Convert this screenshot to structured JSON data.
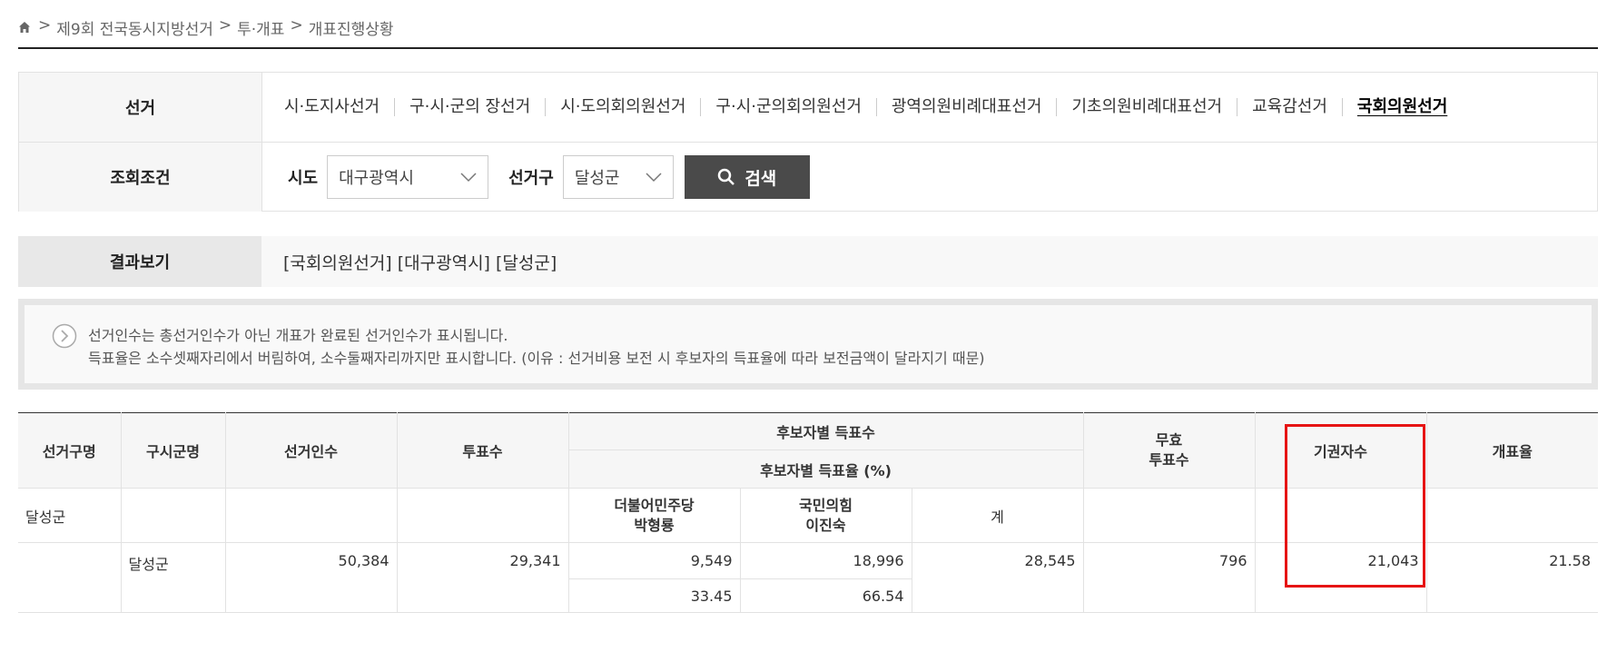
{
  "breadcrumb": {
    "items": [
      "제9회 전국동시지방선거",
      "투·개표",
      "개표진행상황"
    ],
    "separator": ">"
  },
  "search": {
    "election_label": "선거",
    "election_tabs": [
      {
        "label": "시·도지사선거",
        "active": false
      },
      {
        "label": "구·시·군의 장선거",
        "active": false
      },
      {
        "label": "시·도의회의원선거",
        "active": false
      },
      {
        "label": "구·시·군의회의원선거",
        "active": false
      },
      {
        "label": "광역의원비례대표선거",
        "active": false
      },
      {
        "label": "기초의원비례대표선거",
        "active": false
      },
      {
        "label": "교육감선거",
        "active": false
      },
      {
        "label": "국회의원선거",
        "active": true
      }
    ],
    "condition_label": "조회조건",
    "sido_label": "시도",
    "sido_value": "대구광역시",
    "district_label": "선거구",
    "district_value": "달성군",
    "search_button": "검색"
  },
  "result": {
    "label": "결과보기",
    "text": "[국회의원선거] [대구광역시] [달성군]"
  },
  "notice": {
    "line1": "선거인수는 총선거인수가 아닌 개표가 완료된 선거인수가 표시됩니다.",
    "line2": "득표율은 소수셋째자리에서 버림하여, 소수둘째자리까지만 표시합니다. (이유 : 선거비용 보전 시 후보자의 득표율에 따라 보전금액이 달라지기 때문)"
  },
  "table": {
    "headers": {
      "district": "선거구명",
      "sigungu": "구시군명",
      "electors": "선거인수",
      "votes": "투표수",
      "candidate_votes": "후보자별 득표수",
      "candidate_rate": "후보자별 득표율 (%)",
      "invalid": "무효\n투표수",
      "abstain": "기권자수",
      "count_rate": "개표율"
    },
    "district_row": {
      "district": "달성군",
      "party1": "더불어민주당",
      "candidate1": "박형룡",
      "party2": "국민의힘",
      "candidate2": "이진숙",
      "total_label": "계"
    },
    "data_row": {
      "sigungu": "달성군",
      "electors": "50,384",
      "votes": "29,341",
      "cand1_votes": "9,549",
      "cand2_votes": "18,996",
      "total_votes": "28,545",
      "invalid": "796",
      "abstain": "21,043",
      "count_rate": "21.58",
      "cand1_rate": "33.45",
      "cand2_rate": "66.54"
    }
  },
  "colors": {
    "highlight": "#e61414",
    "button": "#4a4a4a"
  }
}
